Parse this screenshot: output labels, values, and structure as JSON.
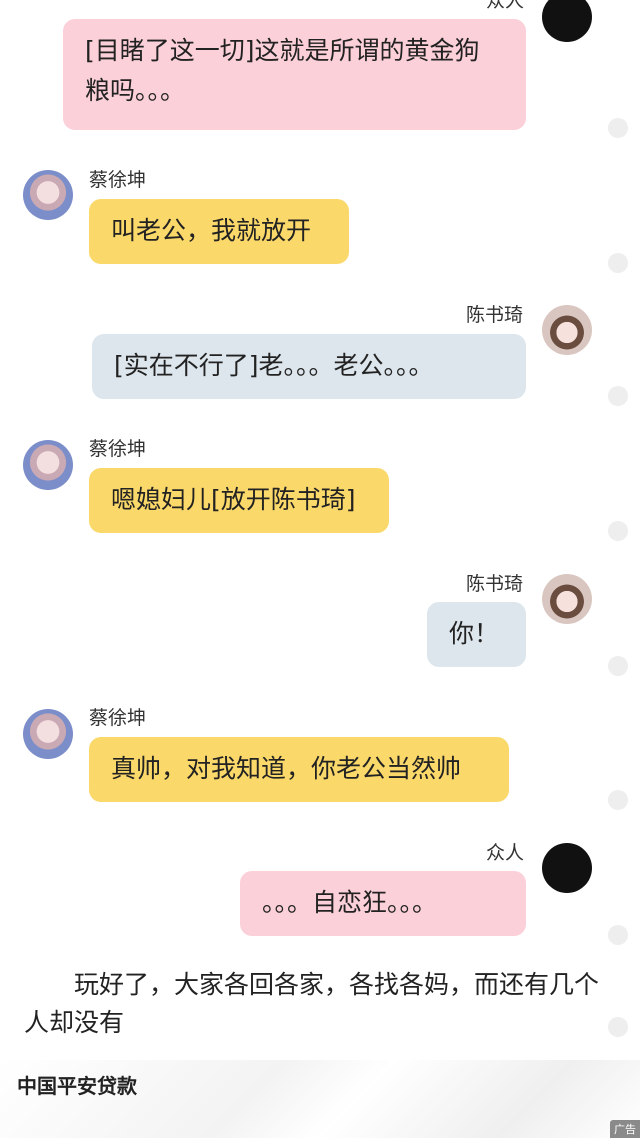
{
  "messages": [
    {
      "name": "众人",
      "text": "[目睹了这一切]这就是所谓的黄金狗粮吗。。。",
      "avatar": "crowd-avatar"
    },
    {
      "name": "蔡徐坤",
      "text": "叫老公，我就放开",
      "avatar": "kun-avatar"
    },
    {
      "name": "陈书琦",
      "text": "[实在不行了]老。。。老公。。。",
      "avatar": "qi-avatar"
    },
    {
      "name": "蔡徐坤",
      "text": "嗯媳妇儿[放开陈书琦]",
      "avatar": "kun-avatar"
    },
    {
      "name": "陈书琦",
      "text": "你！",
      "avatar": "qi-avatar"
    },
    {
      "name": "蔡徐坤",
      "text": "真帅，对我知道，你老公当然帅",
      "avatar": "kun-avatar"
    },
    {
      "name": "众人",
      "text": "。。。自恋狂。。。",
      "avatar": "crowd-avatar"
    }
  ],
  "narration": "　　玩好了，大家各回各家，各找各妈，而还有几个人却没有",
  "ad": {
    "title": "中国平安贷款",
    "tag": "广告"
  },
  "colors": {
    "kun_bubble": "#fbd86a",
    "crowd_bubble": "#fbd0d9",
    "qi_bubble": "#dde6ec"
  }
}
